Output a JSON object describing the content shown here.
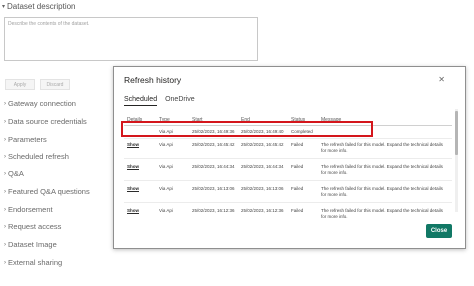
{
  "settings": {
    "dataset_description_header": "Dataset description",
    "description_placeholder": "Describe the contents of the dataset.",
    "apply_label": "Apply",
    "discard_label": "Discard",
    "sections": [
      "Gateway connection",
      "Data source credentials",
      "Parameters",
      "Scheduled refresh",
      "Q&A",
      "Featured Q&A questions",
      "Endorsement",
      "Request access",
      "Dataset Image",
      "External sharing"
    ]
  },
  "modal": {
    "title": "Refresh history",
    "close_icon": "close-icon",
    "tabs": [
      "Scheduled",
      "OneDrive"
    ],
    "active_tab": "Scheduled",
    "columns": [
      "Details",
      "Type",
      "Start",
      "End",
      "Status",
      "Message"
    ],
    "rows": [
      {
        "details": "",
        "type": "Via Api",
        "start": "25/02/2023, 16:49:36",
        "end": "25/02/2023, 16:49:40",
        "status": "Completed",
        "message": ""
      },
      {
        "details": "Show",
        "type": "Via Api",
        "start": "25/02/2023, 16:45:42",
        "end": "25/02/2023, 16:45:42",
        "status": "Failed",
        "message": "The refresh failed for this model. Expand the technical details for more info."
      },
      {
        "details": "Show",
        "type": "Via Api",
        "start": "25/02/2023, 16:44:34",
        "end": "25/02/2023, 16:44:34",
        "status": "Failed",
        "message": "The refresh failed for this model. Expand the technical details for more info."
      },
      {
        "details": "Show",
        "type": "Via Api",
        "start": "25/02/2023, 16:13:06",
        "end": "25/02/2023, 16:13:06",
        "status": "Failed",
        "message": "The refresh failed for this model. Expand the technical details for more info."
      },
      {
        "details": "Show",
        "type": "Via Api",
        "start": "25/02/2023, 16:12:36",
        "end": "25/02/2023, 16:12:36",
        "status": "Failed",
        "message": "The refresh failed for this model. Expand the technical details for more info."
      }
    ],
    "close_button_label": "Close",
    "highlight_color": "#d4161c",
    "close_button_color": "#117865"
  }
}
